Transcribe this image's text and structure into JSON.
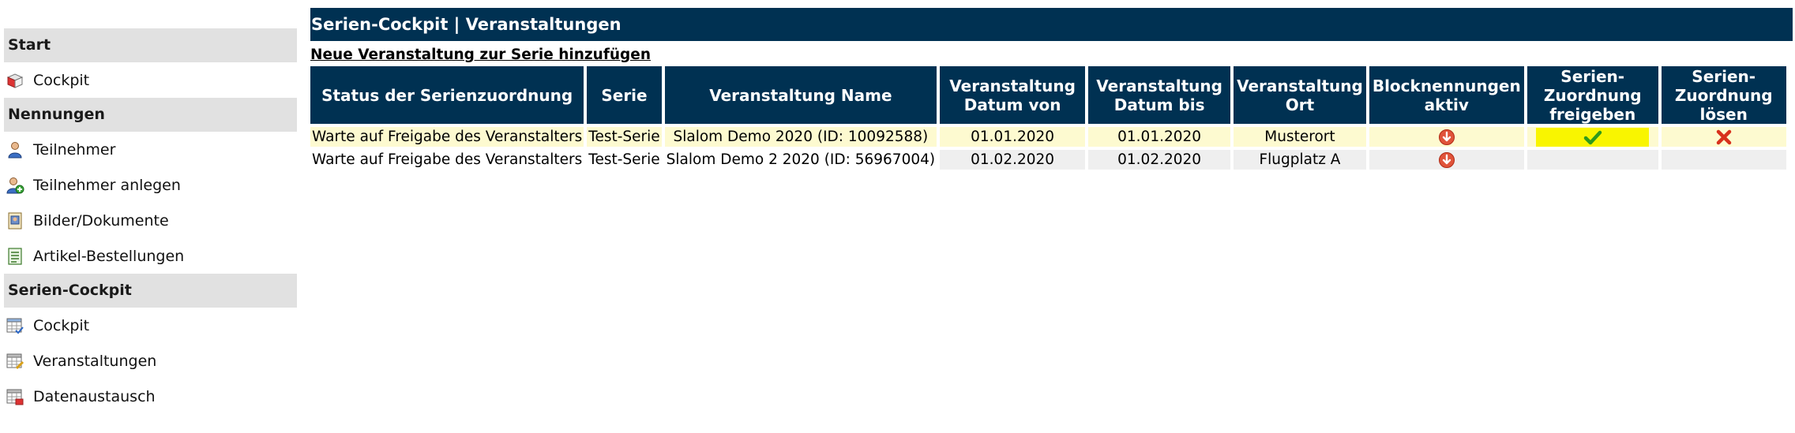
{
  "sidebar": {
    "sections": [
      {
        "title": "Start",
        "items": [
          {
            "label": "Cockpit",
            "icon": "package-icon"
          }
        ]
      },
      {
        "title": "Nennungen",
        "items": [
          {
            "label": "Teilnehmer",
            "icon": "person-icon"
          },
          {
            "label": "Teilnehmer anlegen",
            "icon": "person-add-icon"
          },
          {
            "label": "Bilder/Dokumente",
            "icon": "image-document-icon"
          },
          {
            "label": "Artikel-Bestellungen",
            "icon": "order-list-icon"
          }
        ]
      },
      {
        "title": "Serien-Cockpit",
        "items": [
          {
            "label": "Cockpit",
            "icon": "table-check-icon"
          },
          {
            "label": "Veranstaltungen",
            "icon": "table-edit-icon"
          },
          {
            "label": "Datenaustausch",
            "icon": "table-export-icon"
          }
        ]
      }
    ]
  },
  "header": {
    "title": "Serien-Cockpit | Veranstaltungen"
  },
  "add_link": "Neue Veranstaltung zur Serie hinzufügen",
  "table": {
    "columns": [
      "Status der Serienzuordnung",
      "Serie",
      "Veranstaltung Name",
      "Veranstaltung Datum von",
      "Veranstaltung Datum bis",
      "Veranstaltung Ort",
      "Blocknennungen aktiv",
      "Serien-Zuordnung freigeben",
      "Serien-Zuordnung lösen"
    ],
    "rows": [
      {
        "status": "Warte auf Freigabe des Veranstalters",
        "serie": "Test-Serie",
        "name": "Slalom Demo 2020 (ID: 10092588)",
        "datum_von": "01.01.2020",
        "datum_bis": "01.01.2020",
        "ort": "Musterort",
        "blocknennungen_icon": "red-down-arrow-icon",
        "freigeben_icon": "green-check-icon",
        "loesen_icon": "red-x-icon",
        "highlighted": true
      },
      {
        "status": "Warte auf Freigabe des Veranstalters",
        "serie": "Test-Serie",
        "name": "Slalom Demo 2 2020 (ID: 56967004)",
        "datum_von": "01.02.2020",
        "datum_bis": "01.02.2020",
        "ort": "Flugplatz A",
        "blocknennungen_icon": "red-down-arrow-icon",
        "freigeben_icon": "",
        "loesen_icon": "",
        "highlighted": false
      }
    ]
  },
  "colors": {
    "header_bg": "#003152",
    "section_bg": "#e1e1e1",
    "row_highlight": "#fdfad0",
    "row_default": "#efefef",
    "marker_yellow": "#f9f500"
  }
}
